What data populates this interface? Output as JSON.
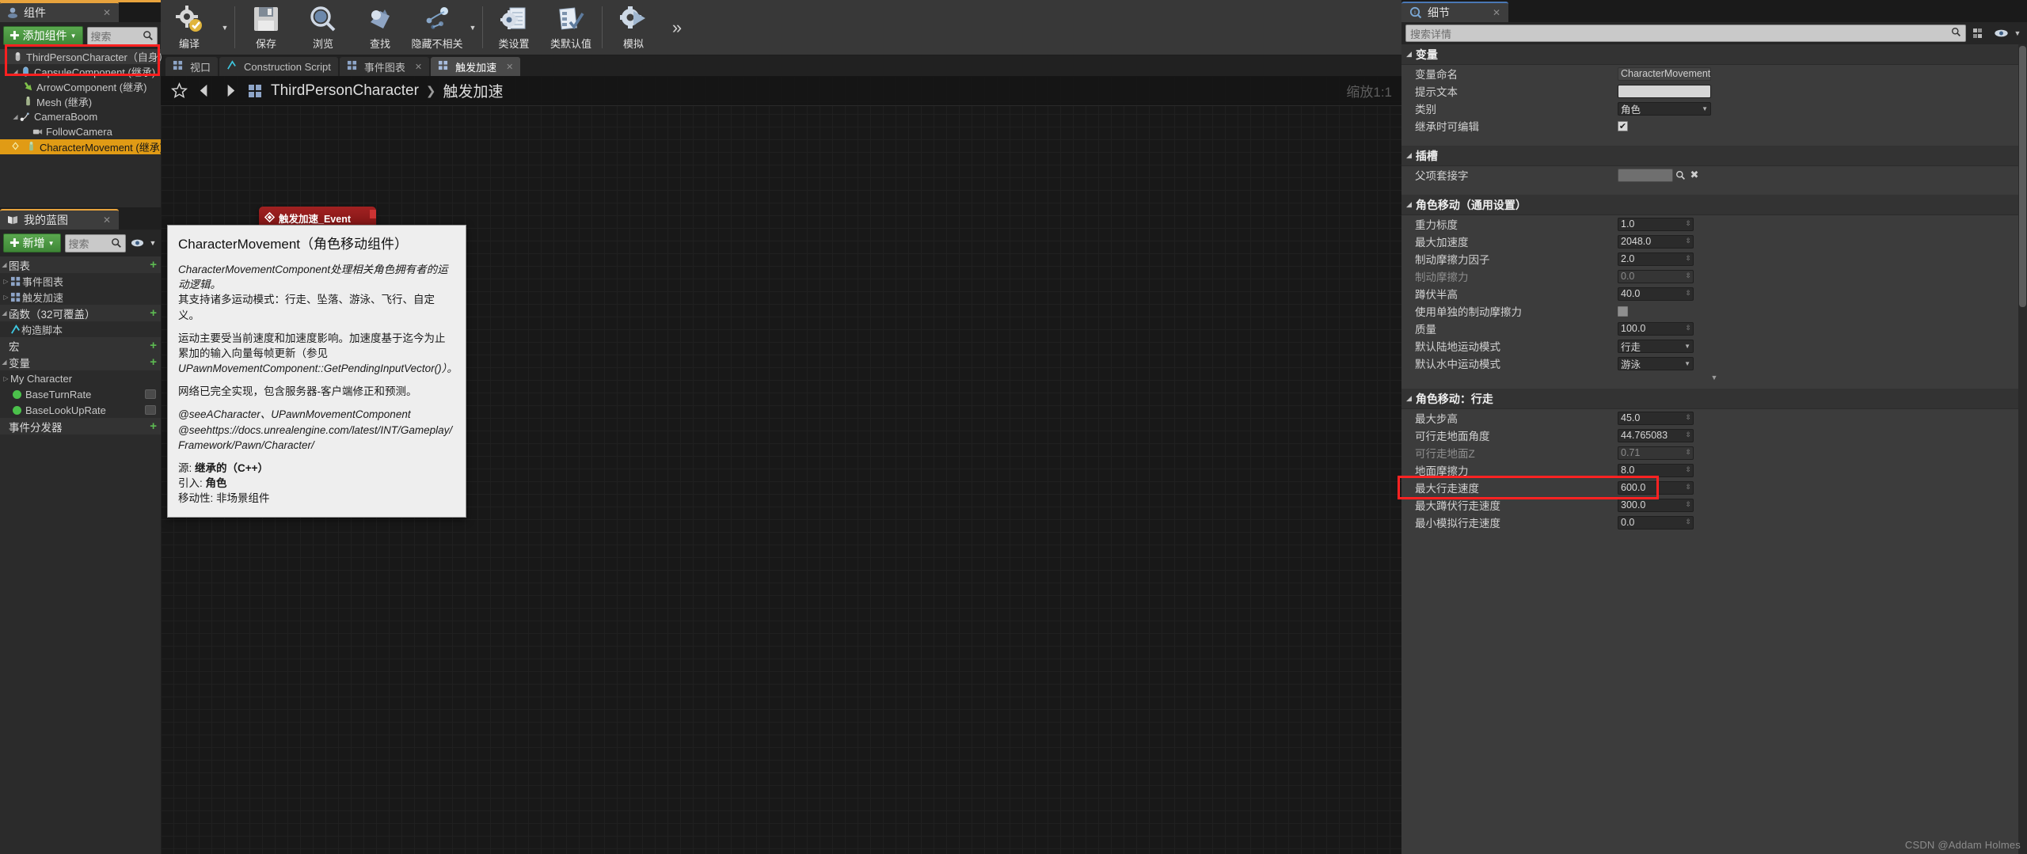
{
  "components_panel": {
    "tab_label": "组件",
    "tab_icon": "components-icon",
    "add_button": "添加组件",
    "search_placeholder": "搜索",
    "tree": [
      {
        "label": "ThirdPersonCharacter（自身）",
        "icon": "pawn-icon",
        "depth": 0,
        "expander": "",
        "selected": false,
        "root": true
      },
      {
        "label": "CapsuleComponent (继承)",
        "icon": "capsule-icon",
        "depth": 1,
        "expander": "▼",
        "selected": false,
        "root": false
      },
      {
        "label": "ArrowComponent (继承)",
        "icon": "arrow-icon",
        "depth": 2,
        "expander": "",
        "selected": false,
        "root": false
      },
      {
        "label": "Mesh (继承)",
        "icon": "mesh-icon",
        "depth": 2,
        "expander": "",
        "selected": false,
        "root": false
      },
      {
        "label": "CameraBoom",
        "icon": "spring-arm-icon",
        "depth": 1,
        "expander": "▼",
        "selected": false,
        "root": false
      },
      {
        "label": "FollowCamera",
        "icon": "camera-icon",
        "depth": 2,
        "expander": "",
        "selected": false,
        "root": false
      },
      {
        "label": "CharacterMovement (继承)",
        "icon": "character-movement-icon",
        "depth": 1,
        "expander": "",
        "selected": true,
        "root": false
      }
    ]
  },
  "my_blueprint_panel": {
    "tab_label": "我的蓝图",
    "tab_icon": "book-icon",
    "add_button": "新增",
    "search_placeholder": "搜索",
    "eye_icon": "eye-icon",
    "sections": [
      {
        "label": "图表",
        "add": "+",
        "items": [
          {
            "label": "事件图表",
            "icon": "graph-icon",
            "kind": "graph"
          },
          {
            "label": "触发加速",
            "icon": "graph-icon",
            "kind": "graph"
          }
        ]
      },
      {
        "label": "函数（32可覆盖）",
        "add": "+",
        "items": [
          {
            "label": "构造脚本",
            "icon": "function-icon",
            "kind": "function"
          }
        ]
      },
      {
        "label": "宏",
        "add": "+",
        "items": []
      },
      {
        "label": "变量",
        "add": "+",
        "items": [
          {
            "label": "My Character",
            "icon": "category-icon",
            "kind": "category"
          },
          {
            "label": "BaseTurnRate",
            "icon": "float-var-icon",
            "kind": "variable",
            "color": "#4bc14b"
          },
          {
            "label": "BaseLookUpRate",
            "icon": "float-var-icon",
            "kind": "variable",
            "color": "#4bc14b"
          }
        ]
      },
      {
        "label": "事件分发器",
        "add": "+",
        "items": []
      }
    ]
  },
  "toolbar": {
    "items": [
      {
        "label": "编译",
        "icon": "compile-icon",
        "has_dropdown": true
      },
      {
        "label": "保存",
        "icon": "save-icon",
        "has_dropdown": false
      },
      {
        "label": "浏览",
        "icon": "browse-icon",
        "has_dropdown": false
      },
      {
        "label": "查找",
        "icon": "find-icon",
        "has_dropdown": false
      },
      {
        "label": "隐藏不相关",
        "icon": "hide-unrelated-icon",
        "has_dropdown": true
      },
      {
        "label": "类设置",
        "icon": "class-settings-icon",
        "has_dropdown": false
      },
      {
        "label": "类默认值",
        "icon": "class-defaults-icon",
        "has_dropdown": false
      },
      {
        "label": "模拟",
        "icon": "simulate-icon",
        "has_dropdown": false
      }
    ],
    "overflow_icon": "chevron-double-right-icon"
  },
  "graph_tabs": [
    {
      "label": "视口",
      "icon": "viewport-icon",
      "active": false,
      "closable": false
    },
    {
      "label": "Construction Script",
      "icon": "function-icon",
      "active": false,
      "closable": false
    },
    {
      "label": "事件图表",
      "icon": "graph-icon",
      "active": false,
      "closable": true
    },
    {
      "label": "触发加速",
      "icon": "graph-icon",
      "active": true,
      "closable": true
    }
  ],
  "graph": {
    "star_icon": "star-icon",
    "back_icon": "arrow-left-icon",
    "forward_icon": "arrow-right-icon",
    "breadcrumb_icon": "blueprint-icon",
    "breadcrumb_root": "ThirdPersonCharacter",
    "breadcrumb_sep": "❯",
    "breadcrumb_current": "触发加速",
    "zoom_label": "缩放1:1",
    "node": {
      "title": "触发加速_Event",
      "icon": "event-node-icon"
    }
  },
  "tooltip": {
    "title": "CharacterMovement（角色移动组件）",
    "line_italic": "CharacterMovementComponent处理相关角色拥有者的运动逻辑。",
    "line2": "其支持诸多运动模式：行走、坠落、游泳、飞行、自定义。",
    "para2_l1": "运动主要受当前速度和加速度影响。加速度基于迄今为止",
    "para2_l2": "累加的输入向量每帧更新（参见",
    "para2_l3": "UPawnMovementComponent::GetPendingInputVector()）。",
    "para3": "网络已完全实现，包含服务器-客户端修正和预测。",
    "see_line1": "@seeACharacter、UPawnMovementComponent",
    "see_line2": "@seehttps://docs.unrealengine.com/latest/INT/Gameplay/",
    "see_line3": "Framework/Pawn/Character/",
    "source_key": "源:",
    "source_val": "继承的（C++）",
    "import_key": "引入:",
    "import_val": "角色",
    "mobility_key": "移动性:",
    "mobility_val": "非场景组件"
  },
  "details_panel": {
    "tab_label": "细节",
    "tab_icon": "details-icon",
    "search_placeholder": "搜索详情",
    "grid_icon": "grid-view-icon",
    "eye_icon": "eye-icon",
    "sections": [
      {
        "title": "变量",
        "rows": [
          {
            "label": "变量命名",
            "type": "text",
            "value": "CharacterMovement",
            "readonly": true
          },
          {
            "label": "提示文本",
            "type": "text",
            "value": ""
          },
          {
            "label": "类别",
            "type": "combo",
            "value": "角色"
          },
          {
            "label": "继承时可编辑",
            "type": "checkbox",
            "value": true
          }
        ]
      },
      {
        "title": "插槽",
        "rows": [
          {
            "label": "父项套接字",
            "type": "socket",
            "value": "",
            "icons": [
              "search-icon",
              "clear-icon"
            ]
          }
        ]
      },
      {
        "title": "角色移动（通用设置）",
        "rows": [
          {
            "label": "重力标度",
            "type": "number",
            "value": "1.0"
          },
          {
            "label": "最大加速度",
            "type": "number",
            "value": "2048.0"
          },
          {
            "label": "制动摩擦力因子",
            "type": "number",
            "value": "2.0"
          },
          {
            "label": "制动摩擦力",
            "type": "number",
            "value": "0.0",
            "dim": true
          },
          {
            "label": "蹲伏半高",
            "type": "number",
            "value": "40.0"
          },
          {
            "label": "使用单独的制动摩擦力",
            "type": "checkbox",
            "value": false
          },
          {
            "label": "质量",
            "type": "number",
            "value": "100.0"
          },
          {
            "label": "默认陆地运动模式",
            "type": "combo",
            "value": "行走"
          },
          {
            "label": "默认水中运动模式",
            "type": "combo",
            "value": "游泳"
          }
        ]
      },
      {
        "title": "角色移动：行走",
        "rows": [
          {
            "label": "最大步高",
            "type": "number",
            "value": "45.0"
          },
          {
            "label": "可行走地面角度",
            "type": "number",
            "value": "44.765083"
          },
          {
            "label": "可行走地面Z",
            "type": "number",
            "value": "0.71",
            "dim": true
          },
          {
            "label": "地面摩擦力",
            "type": "number",
            "value": "8.0"
          },
          {
            "label": "最大行走速度",
            "type": "number",
            "value": "600.0",
            "highlight": true
          },
          {
            "label": "最大蹲伏行走速度",
            "type": "number",
            "value": "300.0"
          },
          {
            "label": "最小模拟行走速度",
            "type": "number",
            "value": "0.0"
          }
        ]
      }
    ]
  },
  "watermark": "CSDN @Addam Holmes",
  "colors": {
    "accent_orange": "#e09b15",
    "highlight_red": "#ff2222",
    "green_button": "#4f9a43",
    "tab_blue": "#4a78b5"
  }
}
